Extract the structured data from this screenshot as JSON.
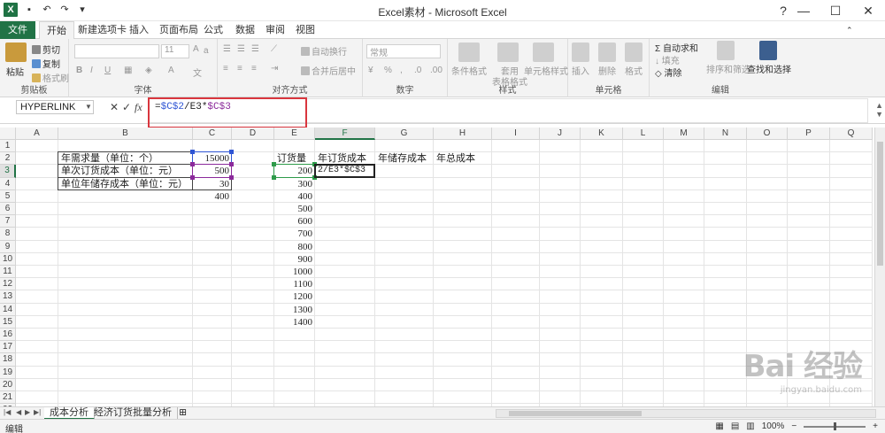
{
  "window": {
    "title": "Excel素材 - Microsoft Excel",
    "app_icon": "X",
    "controls": {
      "minimize": "—",
      "maximize": "☐",
      "close": "✕"
    }
  },
  "ribbon_tabs": [
    "文件",
    "开始",
    "新建选项卡",
    "插入",
    "页面布局",
    "公式",
    "数据",
    "审阅",
    "视图"
  ],
  "ribbon": {
    "clipboard": {
      "paste": "粘贴",
      "cut": "剪切",
      "copy": "复制",
      "format_painter": "格式刷",
      "label": "剪贴板"
    },
    "font": {
      "font_name": "",
      "font_size": "11",
      "label": "字体"
    },
    "alignment": {
      "wrap_text": "自动换行",
      "merge_center": "合并后居中",
      "label": "对齐方式"
    },
    "number": {
      "format": "常规",
      "label": "数字"
    },
    "styles": {
      "conditional": "条件格式",
      "table_1": "套用",
      "table_2": "表格格式",
      "cell_styles": "单元格样式",
      "label": "样式"
    },
    "cells": {
      "insert": "插入",
      "delete": "删除",
      "format": "格式",
      "label": "单元格"
    },
    "editing": {
      "autosum": "自动求和",
      "fill": "填充",
      "clear": "清除",
      "sort_filter": "排序和筛选",
      "find_select": "查找和选择",
      "label": "编辑"
    }
  },
  "formula_bar": {
    "name_box": "HYPERLINK",
    "cancel": "✕",
    "enter": "✓",
    "fx": "fx",
    "formula_prefix": "=",
    "formula_ref1": "$C$2",
    "formula_mid": "/E3*",
    "formula_ref2": "$C$3"
  },
  "columns": [
    "A",
    "B",
    "C",
    "D",
    "E",
    "F",
    "G",
    "H",
    "I",
    "J",
    "K",
    "L",
    "M",
    "N",
    "O",
    "P",
    "Q"
  ],
  "rows": [
    "1",
    "2",
    "3",
    "4",
    "5",
    "6",
    "7",
    "8",
    "9",
    "10",
    "11",
    "12",
    "13",
    "14",
    "15",
    "16",
    "17",
    "18",
    "19",
    "20",
    "21",
    "22"
  ],
  "cells": {
    "B2": "年需求量（单位：个）",
    "B3": "单次订货成本（单位：元）",
    "B4": "单位年储存成本（单位：元）",
    "C2": "15000",
    "C3": "500",
    "C4": "30",
    "C5": "400",
    "E2": "订货量",
    "F2": "年订货成本",
    "G2": "年储存成本",
    "H2": "年总成本",
    "F3": "2/E3*$C$3",
    "E_values": [
      "200",
      "300",
      "400",
      "500",
      "600",
      "700",
      "800",
      "900",
      "1000",
      "1100",
      "1200",
      "1300",
      "1400"
    ]
  },
  "sheets": [
    "成本分析",
    "经济订货批量分析"
  ],
  "status": {
    "mode": "编辑",
    "zoom": "100%"
  },
  "watermark": {
    "logo": "Bai 经验",
    "url": "jingyan.baidu.com"
  }
}
